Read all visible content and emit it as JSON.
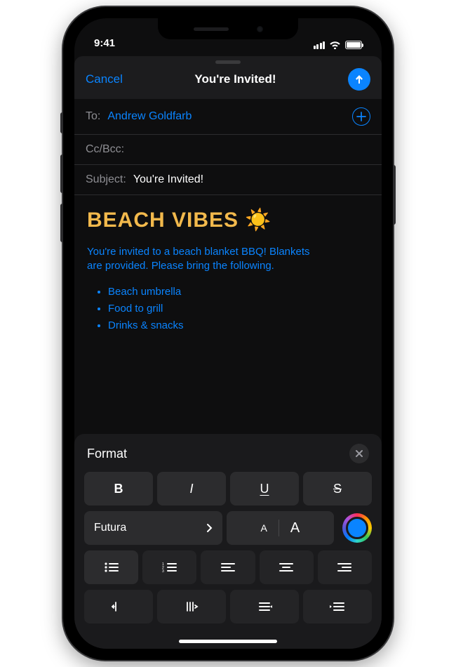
{
  "status": {
    "time": "9:41"
  },
  "navbar": {
    "cancel": "Cancel",
    "title": "You're Invited!"
  },
  "compose": {
    "to_label": "To:",
    "to_recipient": "Andrew Goldfarb",
    "ccbcc_label": "Cc/Bcc:",
    "subject_label": "Subject:",
    "subject_value": "You're Invited!"
  },
  "body": {
    "heading": "BEACH VIBES ☀️",
    "paragraph": "You're invited to a beach blanket BBQ! Blankets are provided. Please bring the following.",
    "items": [
      "Beach umbrella",
      "Food to grill",
      "Drinks & snacks"
    ]
  },
  "format": {
    "title": "Format",
    "bold": "B",
    "italic": "I",
    "underline": "U",
    "strike": "S",
    "font_name": "Futura",
    "size_small": "A",
    "size_large": "A",
    "selected_color": "#0a84ff"
  },
  "colors": {
    "accent": "#0a84ff",
    "heading": "#f2b94c"
  }
}
